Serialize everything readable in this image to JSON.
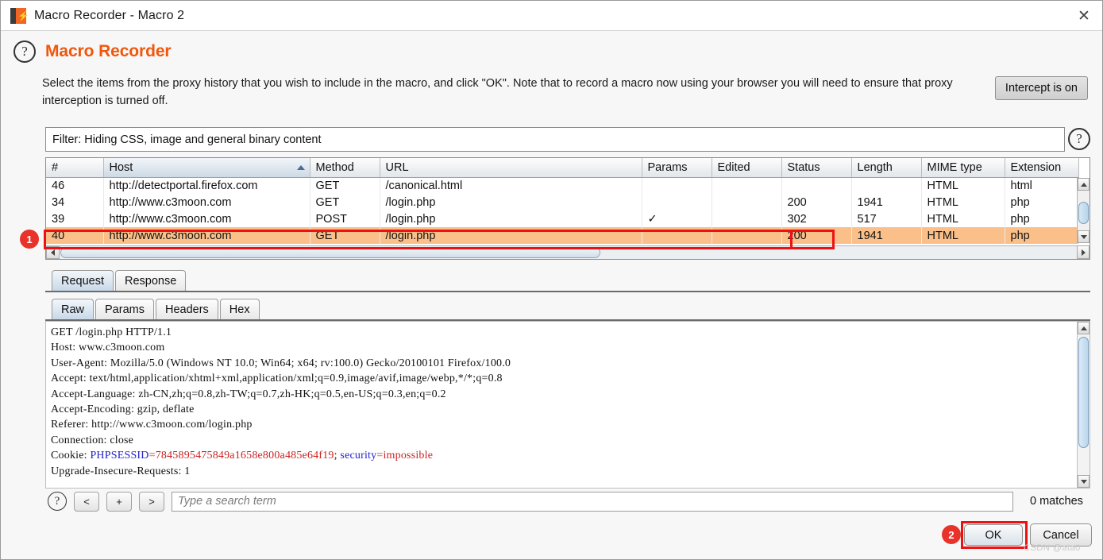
{
  "window": {
    "title": "Macro Recorder - Macro 2",
    "app_icon": "burp-suite-icon",
    "close_label": "✕"
  },
  "header": {
    "help_icon_label": "?",
    "title": "Macro Recorder",
    "description": "Select the items from the proxy history that you wish to include in the macro, and click \"OK\". Note that to record a macro now using your browser you will need to ensure that proxy interception is turned off.",
    "accent_color": "#f2560a"
  },
  "intercept": {
    "label": "Intercept is on"
  },
  "filter": {
    "text": "Filter: Hiding CSS, image and general binary content",
    "help_label": "?"
  },
  "table": {
    "columns": [
      "#",
      "Host",
      "Method",
      "URL",
      "Params",
      "Edited",
      "Status",
      "Length",
      "MIME type",
      "Extension"
    ],
    "sorted_column": "Host",
    "sort_direction": "asc",
    "rows": [
      {
        "num": "46",
        "host": "http://detectportal.firefox.com",
        "method": "GET",
        "url": "/canonical.html",
        "params": "",
        "edited": "",
        "status": "",
        "length": "",
        "mime": "HTML",
        "ext": "html",
        "selected": false
      },
      {
        "num": "34",
        "host": "http://www.c3moon.com",
        "method": "GET",
        "url": "/login.php",
        "params": "",
        "edited": "",
        "status": "200",
        "length": "1941",
        "mime": "HTML",
        "ext": "php",
        "selected": false
      },
      {
        "num": "39",
        "host": "http://www.c3moon.com",
        "method": "POST",
        "url": "/login.php",
        "params": "✓",
        "edited": "",
        "status": "302",
        "length": "517",
        "mime": "HTML",
        "ext": "php",
        "selected": false
      },
      {
        "num": "40",
        "host": "http://www.c3moon.com",
        "method": "GET",
        "url": "/login.php",
        "params": "",
        "edited": "",
        "status": "200",
        "length": "1941",
        "mime": "HTML",
        "ext": "php",
        "selected": true
      }
    ]
  },
  "annotations": {
    "badge1": "1",
    "badge2": "2",
    "highlight_color": "#ee1111"
  },
  "message_tabs": {
    "primary": [
      {
        "label": "Request",
        "active": true
      },
      {
        "label": "Response",
        "active": false
      }
    ],
    "secondary": [
      {
        "label": "Raw",
        "active": true
      },
      {
        "label": "Params",
        "active": false
      },
      {
        "label": "Headers",
        "active": false
      },
      {
        "label": "Hex",
        "active": false
      }
    ]
  },
  "request": {
    "lines": [
      "GET /login.php HTTP/1.1",
      "Host: www.c3moon.com",
      "User-Agent: Mozilla/5.0 (Windows NT 10.0; Win64; x64; rv:100.0) Gecko/20100101 Firefox/100.0",
      "Accept: text/html,application/xhtml+xml,application/xml;q=0.9,image/avif,image/webp,*/*;q=0.8",
      "Accept-Language: zh-CN,zh;q=0.8,zh-TW;q=0.7,zh-HK;q=0.5,en-US;q=0.3,en;q=0.2",
      "Accept-Encoding: gzip, deflate",
      "Referer: http://www.c3moon.com/login.php",
      "Connection: close"
    ],
    "cookie_label": "Cookie: ",
    "cookie_key1": "PHPSESSID",
    "cookie_val1": "=7845895475849a1658e800a485e64f19",
    "cookie_sep": "; ",
    "cookie_key2": "security",
    "cookie_val2": "=impossible",
    "last_line": "Upgrade-Insecure-Requests: 1"
  },
  "search": {
    "help_label": "?",
    "prev_label": "<",
    "add_label": "+",
    "next_label": ">",
    "placeholder": "Type a search term",
    "value": "",
    "matches": "0 matches"
  },
  "footer": {
    "ok_label": "OK",
    "cancel_label": "Cancel",
    "watermark": "CSDN @ata0"
  }
}
